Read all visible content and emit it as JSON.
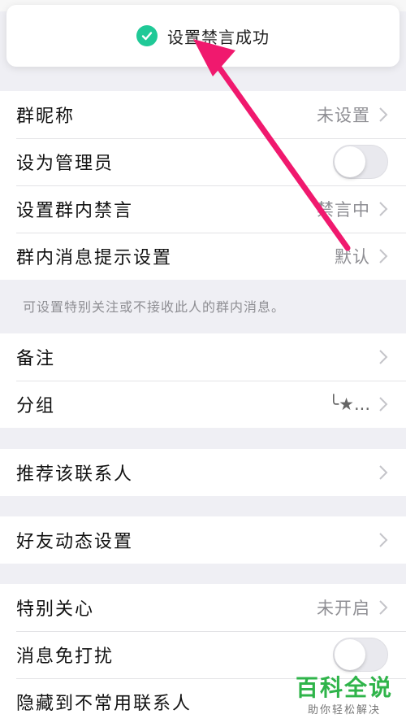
{
  "toast": {
    "message": "设置禁言成功",
    "icon": "check-circle-icon",
    "icon_color": "#20c997"
  },
  "section1": {
    "rows": [
      {
        "label": "群昵称",
        "value": "未设置"
      },
      {
        "label": "设为管理员",
        "toggle": false
      },
      {
        "label": "设置群内禁言",
        "value": "禁言中"
      },
      {
        "label": "群内消息提示设置",
        "value": "默认"
      }
    ],
    "hint": "可设置特别关注或不接收此人的群内消息。"
  },
  "section2": {
    "rows": [
      {
        "label": "备注"
      },
      {
        "label": "分组",
        "value": "╰★..."
      }
    ]
  },
  "section3": {
    "rows": [
      {
        "label": "推荐该联系人"
      }
    ]
  },
  "section4": {
    "rows": [
      {
        "label": "好友动态设置"
      }
    ]
  },
  "section5": {
    "rows": [
      {
        "label": "特别关心",
        "value": "未开启"
      },
      {
        "label": "消息免打扰",
        "toggle": false
      },
      {
        "label": "隐藏到不常用联系人"
      }
    ]
  },
  "annotation": {
    "arrow_color": "#f0196e"
  },
  "watermark": {
    "title": "百科全说",
    "subtitle": "助你轻松解决",
    "color": "#2fb44a"
  }
}
